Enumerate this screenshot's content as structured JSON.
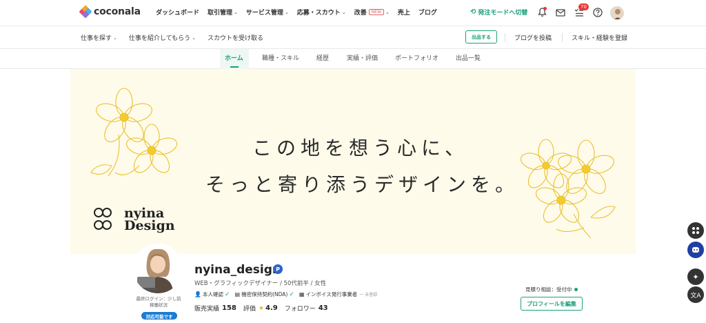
{
  "brand": {
    "name": "coconala",
    "colors": [
      "#e94b6a",
      "#f7a325",
      "#4ab4e8",
      "#9a6fd0"
    ]
  },
  "nav": {
    "items": [
      {
        "label": "ダッシュボード",
        "dropdown": false
      },
      {
        "label": "取引管理",
        "dropdown": true
      },
      {
        "label": "サービス管理",
        "dropdown": true
      },
      {
        "label": "応募・スカウト",
        "dropdown": true
      },
      {
        "label": "改善",
        "dropdown": true,
        "badge": "NEW"
      },
      {
        "label": "売上",
        "dropdown": false
      },
      {
        "label": "ブログ",
        "dropdown": false
      }
    ],
    "seller_mode": "発注モードへ切替",
    "todo_count": "70"
  },
  "subnav": {
    "find_work": "仕事を探す",
    "introduce": "仕事を紹介してもらう",
    "scout": "スカウトを受け取る",
    "post_button": "出品する",
    "blog_post": "ブログを投稿",
    "register_skill": "スキル・経験を登録"
  },
  "tabs": [
    {
      "label": "ホーム",
      "active": true
    },
    {
      "label": "職種・スキル",
      "active": false
    },
    {
      "label": "経歴",
      "active": false
    },
    {
      "label": "実績・評価",
      "active": false
    },
    {
      "label": "ポートフォリオ",
      "active": false
    },
    {
      "label": "出品一覧",
      "active": false
    }
  ],
  "banner": {
    "line1": "この地を想う心に、",
    "line2": "そっと寄り添うデザインを。",
    "brand_line1": "nyina",
    "brand_line2": "Design",
    "background": "#fffbea",
    "flower_color": "#f2cc2e"
  },
  "profile": {
    "username": "nyina_design",
    "plus_badge": "P",
    "subtitle": "WEB・グラフィックデザイナー / 50代前半 / 女性",
    "identity": "本人確認",
    "nda": "機密保持契約(NDA)",
    "invoice": "インボイス発行事業者",
    "invoice_status": "一 未登録",
    "sales_label": "販売実績",
    "sales_value": "158",
    "rating_label": "評価",
    "rating_value": "4.9",
    "followers_label": "フォロワー",
    "followers_value": "43",
    "last_login": "最終ログイン：少し前",
    "status_label": "稼働状況",
    "status_badge": "対応可能です",
    "estimate": "見積り相談：受付中",
    "edit_button": "プロフィールを編集"
  }
}
